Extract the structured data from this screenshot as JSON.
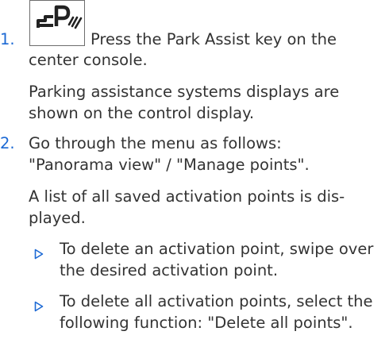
{
  "steps": [
    {
      "number": "1.",
      "key_icon": "park-assist-key-icon",
      "text_lines": [
        "Press the Park Assist key on the",
        "center console."
      ],
      "result_lines": [
        "Parking assistance systems displays are",
        "shown on the control display."
      ]
    },
    {
      "number": "2.",
      "text_lines": [
        "Go through the menu as follows:",
        "\"Panorama view\" / \"Manage points\"."
      ],
      "result_lines": [
        "A list of all saved activation points is dis-",
        "played."
      ],
      "bullets": [
        {
          "lines": [
            "To delete an activation point, swipe over",
            "the desired activation point."
          ]
        },
        {
          "lines": [
            "To delete all activation points, select the",
            "following function: \"Delete all points\"."
          ]
        }
      ]
    }
  ],
  "colors": {
    "accent": "#1c69d4",
    "text": "#333333",
    "icon_border": "#6d6d6d"
  }
}
